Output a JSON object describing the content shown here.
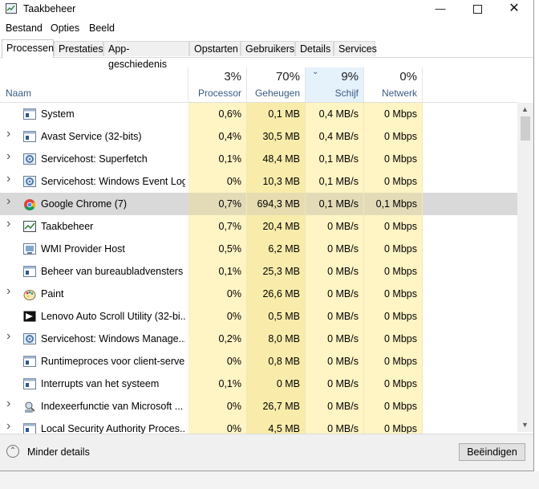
{
  "window": {
    "title": "Taakbeheer"
  },
  "menu": [
    "Bestand",
    "Opties",
    "Beeld"
  ],
  "tabs": [
    {
      "label": "Processen",
      "active": true
    },
    {
      "label": "Prestaties"
    },
    {
      "label": "App-geschiedenis"
    },
    {
      "label": "Opstarten"
    },
    {
      "label": "Gebruikers"
    },
    {
      "label": "Details"
    },
    {
      "label": "Services"
    }
  ],
  "columns": {
    "name": "Naam",
    "cpu": {
      "pct": "3%",
      "label": "Processor"
    },
    "mem": {
      "pct": "70%",
      "label": "Geheugen"
    },
    "disk": {
      "pct": "9%",
      "label": "Schijf"
    },
    "net": {
      "pct": "0%",
      "label": "Netwerk"
    }
  },
  "processes": [
    {
      "name": "System",
      "cpu": "0,6%",
      "mem": "0,1 MB",
      "disk": "0,4 MB/s",
      "net": "0 Mbps",
      "expand": false,
      "icon": "system-window-icon"
    },
    {
      "name": "Avast Service (32-bits)",
      "cpu": "0,4%",
      "mem": "30,5 MB",
      "disk": "0,4 MB/s",
      "net": "0 Mbps",
      "expand": true,
      "icon": "system-window-icon"
    },
    {
      "name": "Servicehost: Superfetch",
      "cpu": "0,1%",
      "mem": "48,4 MB",
      "disk": "0,1 MB/s",
      "net": "0 Mbps",
      "expand": true,
      "icon": "gear-icon"
    },
    {
      "name": "Servicehost: Windows Event Log",
      "cpu": "0%",
      "mem": "10,3 MB",
      "disk": "0,1 MB/s",
      "net": "0 Mbps",
      "expand": true,
      "icon": "gear-icon"
    },
    {
      "name": "Google Chrome (7)",
      "cpu": "0,7%",
      "mem": "694,3 MB",
      "disk": "0,1 MB/s",
      "net": "0,1 Mbps",
      "expand": true,
      "icon": "chrome-icon",
      "selected": true
    },
    {
      "name": "Taakbeheer",
      "cpu": "0,7%",
      "mem": "20,4 MB",
      "disk": "0 MB/s",
      "net": "0 Mbps",
      "expand": true,
      "icon": "task-manager-icon"
    },
    {
      "name": "WMI Provider Host",
      "cpu": "0,5%",
      "mem": "6,2 MB",
      "disk": "0 MB/s",
      "net": "0 Mbps",
      "expand": false,
      "icon": "wmi-icon"
    },
    {
      "name": "Beheer van bureaubladvensters",
      "cpu": "0,1%",
      "mem": "25,3 MB",
      "disk": "0 MB/s",
      "net": "0 Mbps",
      "expand": false,
      "icon": "system-window-icon"
    },
    {
      "name": "Paint",
      "cpu": "0%",
      "mem": "26,6 MB",
      "disk": "0 MB/s",
      "net": "0 Mbps",
      "expand": true,
      "icon": "paint-icon"
    },
    {
      "name": "Lenovo Auto Scroll Utility (32-bi...",
      "cpu": "0%",
      "mem": "0,5 MB",
      "disk": "0 MB/s",
      "net": "0 Mbps",
      "expand": false,
      "icon": "lenovo-icon"
    },
    {
      "name": "Servicehost: Windows Manage...",
      "cpu": "0,2%",
      "mem": "8,0 MB",
      "disk": "0 MB/s",
      "net": "0 Mbps",
      "expand": true,
      "icon": "gear-icon"
    },
    {
      "name": "Runtimeproces voor client-server",
      "cpu": "0%",
      "mem": "0,8 MB",
      "disk": "0 MB/s",
      "net": "0 Mbps",
      "expand": false,
      "icon": "system-window-icon"
    },
    {
      "name": "Interrupts van het systeem",
      "cpu": "0,1%",
      "mem": "0 MB",
      "disk": "0 MB/s",
      "net": "0 Mbps",
      "expand": false,
      "icon": "system-window-icon"
    },
    {
      "name": "Indexeerfunctie van Microsoft ...",
      "cpu": "0%",
      "mem": "26,7 MB",
      "disk": "0 MB/s",
      "net": "0 Mbps",
      "expand": true,
      "icon": "indexer-icon"
    },
    {
      "name": "Local Security Authority Proces...",
      "cpu": "0%",
      "mem": "4,5 MB",
      "disk": "0 MB/s",
      "net": "0 Mbps",
      "expand": true,
      "icon": "system-window-icon"
    }
  ],
  "colors": {
    "heat_light": "#fff4c4",
    "heat_medium": "#f9ecaa",
    "heat_strong": "#f5e08a",
    "sort_header": "#e5f1fb",
    "selected_row": "#d9d9d9"
  },
  "footer": {
    "less_details": "Minder details",
    "end_task": "Beëindigen"
  }
}
